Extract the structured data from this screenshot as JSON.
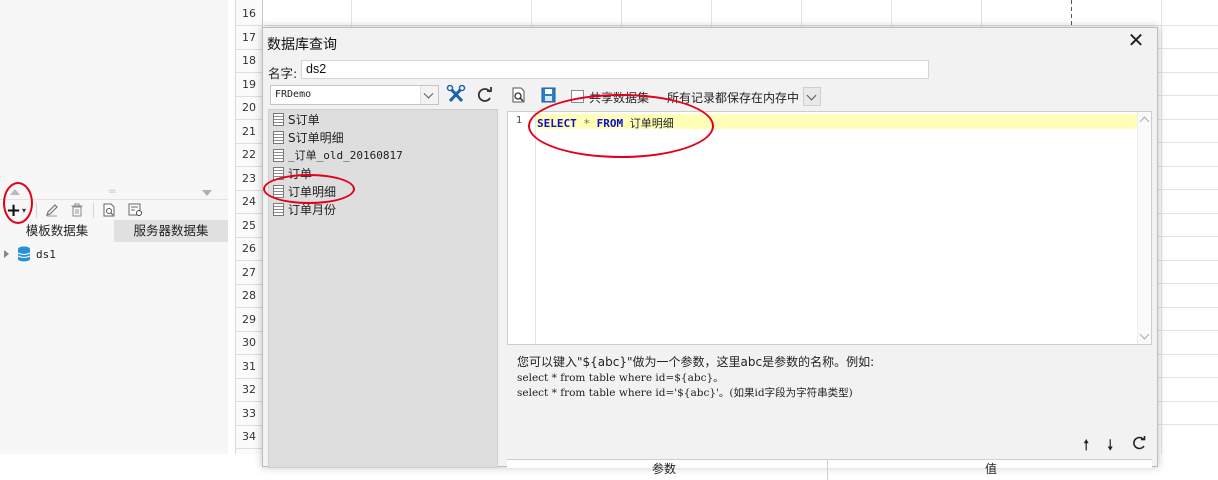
{
  "left_panel": {
    "tabs": [
      "模板数据集",
      "服务器数据集"
    ],
    "tree": [
      {
        "label": "ds1",
        "icon": "database-icon"
      }
    ],
    "toolbar_icons": [
      "add-icon",
      "edit-icon",
      "delete-icon",
      "preview-icon",
      "manage-icon"
    ]
  },
  "sheet": {
    "row_numbers": [
      "16",
      "17",
      "18",
      "19",
      "20",
      "21",
      "22",
      "23",
      "24",
      "25",
      "26",
      "27",
      "28",
      "29",
      "30",
      "31",
      "32",
      "33",
      "34"
    ]
  },
  "dialog": {
    "title": "数据库查询",
    "name_label": "名字:",
    "name_value": "ds2",
    "db_select": "FRDemo",
    "tables": [
      "S订单",
      "S订单明细",
      "_订单_old_20160817",
      "订单",
      "订单明细",
      "订单月份"
    ],
    "share_label": "共享数据集",
    "memory_label": "所有记录都保存在内存中",
    "sql": {
      "line_number": "1",
      "select_kw": "SELECT",
      "star": "*",
      "from_kw": "FROM",
      "table": "订单明细"
    },
    "hints": [
      "您可以键入\"${abc}\"做为一个参数，这里abc是参数的名称。例如:",
      "select * from table where id=${abc}。",
      "select * from table where id='${abc}'。(如果id字段为字符串类型)"
    ],
    "param_columns": [
      "参数",
      "值"
    ]
  },
  "colors": {
    "accent_red": "#e3001b",
    "keyword_blue": "#1010c8",
    "current_line": "#ffffb9"
  }
}
